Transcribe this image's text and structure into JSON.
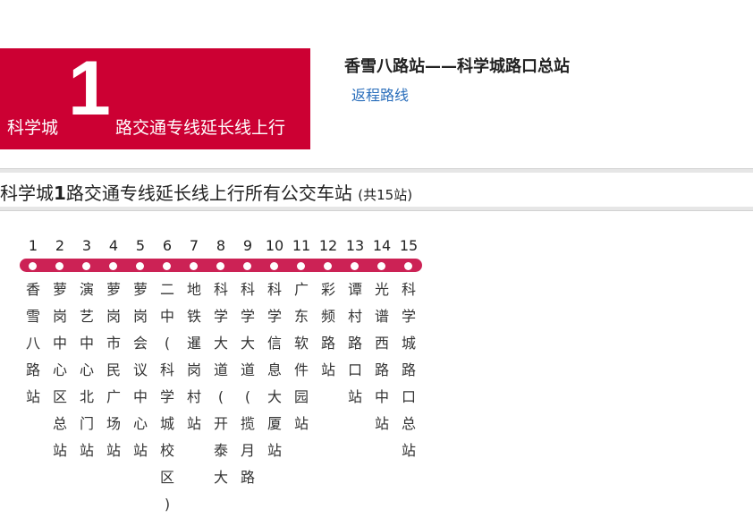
{
  "banner": {
    "prefix": "科学城",
    "number": "1",
    "suffix": "路交通专线延长线上行",
    "color": "#cc0033"
  },
  "header": {
    "route_title": "香雪八路站——科学城路口总站",
    "return_link": "返程路线"
  },
  "list": {
    "heading_prefix": "科学城",
    "heading_number": "1",
    "heading_suffix": "路交通专线延长线上行所有公交车站",
    "count_text": "(共15站)"
  },
  "stations": [
    {
      "num": "1",
      "name": "香雪八路站"
    },
    {
      "num": "2",
      "name": "萝岗中心区总站"
    },
    {
      "num": "3",
      "name": "演艺中心北门站"
    },
    {
      "num": "4",
      "name": "萝岗市民广场站"
    },
    {
      "num": "5",
      "name": "萝岗会议中心站"
    },
    {
      "num": "6",
      "name": "二中(科学城校区)"
    },
    {
      "num": "7",
      "name": "地铁暹岗村站"
    },
    {
      "num": "8",
      "name": "科学大道(开泰大"
    },
    {
      "num": "9",
      "name": "科学大道(揽月路"
    },
    {
      "num": "10",
      "name": "科学信息大厦站"
    },
    {
      "num": "11",
      "name": "广东软件园站"
    },
    {
      "num": "12",
      "name": "彩频路站"
    },
    {
      "num": "13",
      "name": "谭村路口站"
    },
    {
      "num": "14",
      "name": "光谱西路中站"
    },
    {
      "num": "15",
      "name": "科学城路口总站"
    }
  ]
}
